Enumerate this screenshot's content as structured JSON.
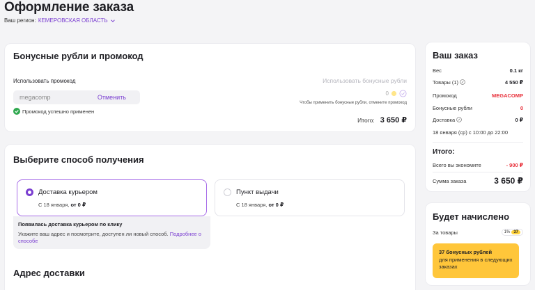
{
  "page": {
    "title": "Оформление заказа"
  },
  "region": {
    "label": "Ваш регион:",
    "value": "КЕМЕРОВСКАЯ ОБЛАСТЬ"
  },
  "bonus_card": {
    "title": "Бонусные рубли и промокод",
    "promo_label": "Использовать промокод",
    "promo_value": "megacomp",
    "cancel_label": "Отменить",
    "promo_success": "Промокод успешно применен",
    "bonus_use_label": "Использовать бонусные рубли",
    "bonus_amount": "0",
    "bonus_hint": "Чтобы применить бонусные рубли, отмените промокод",
    "total_label": "Итого:",
    "total_value": "3 650 ₽"
  },
  "delivery_card": {
    "title": "Выберите способ получения",
    "options": [
      {
        "title": "Доставка курьером",
        "date": "С 18 января,",
        "price": "от 0 ₽",
        "selected": true
      },
      {
        "title": "Пункт выдачи",
        "date": "С 18 января,",
        "price": "от 0 ₽",
        "selected": false
      }
    ],
    "notice_title": "Появилась доставка курьером по клику",
    "notice_text": "Укажите ваш адрес и посмотрите, доступен ли новый способ.",
    "notice_link": "Подробнее о способе",
    "address_title": "Адрес доставки"
  },
  "order_summary": {
    "title": "Ваш заказ",
    "weight_label": "Вес",
    "weight_value": "0.1 кг",
    "goods_label": "Товары (1)",
    "goods_value": "4 550 ₽",
    "promo_label": "Промокод",
    "promo_value": "MEGACOMP",
    "bonus_label": "Бонусные рубли",
    "bonus_value": "0",
    "delivery_label": "Доставка",
    "delivery_value": "0 ₽",
    "delivery_date": "18 января (ср)  с 10:00 до 22:00",
    "itogo_label": "Итого:",
    "savings_label": "Всего вы экономите",
    "savings_value": "- 900 ₽",
    "sum_label": "Сумма заказа",
    "sum_value": "3 650 ₽"
  },
  "earn_card": {
    "title": "Будет начислено",
    "goods_label": "За товары",
    "percent": "1%",
    "coins": "37",
    "bonus_title": "37 бонусных рублей",
    "bonus_text": "для применения в следующих заказах"
  },
  "colors": {
    "accent": "#7b3fd1",
    "red": "#e8303a",
    "yellow": "#ffc63a",
    "success": "#2fa84f"
  }
}
